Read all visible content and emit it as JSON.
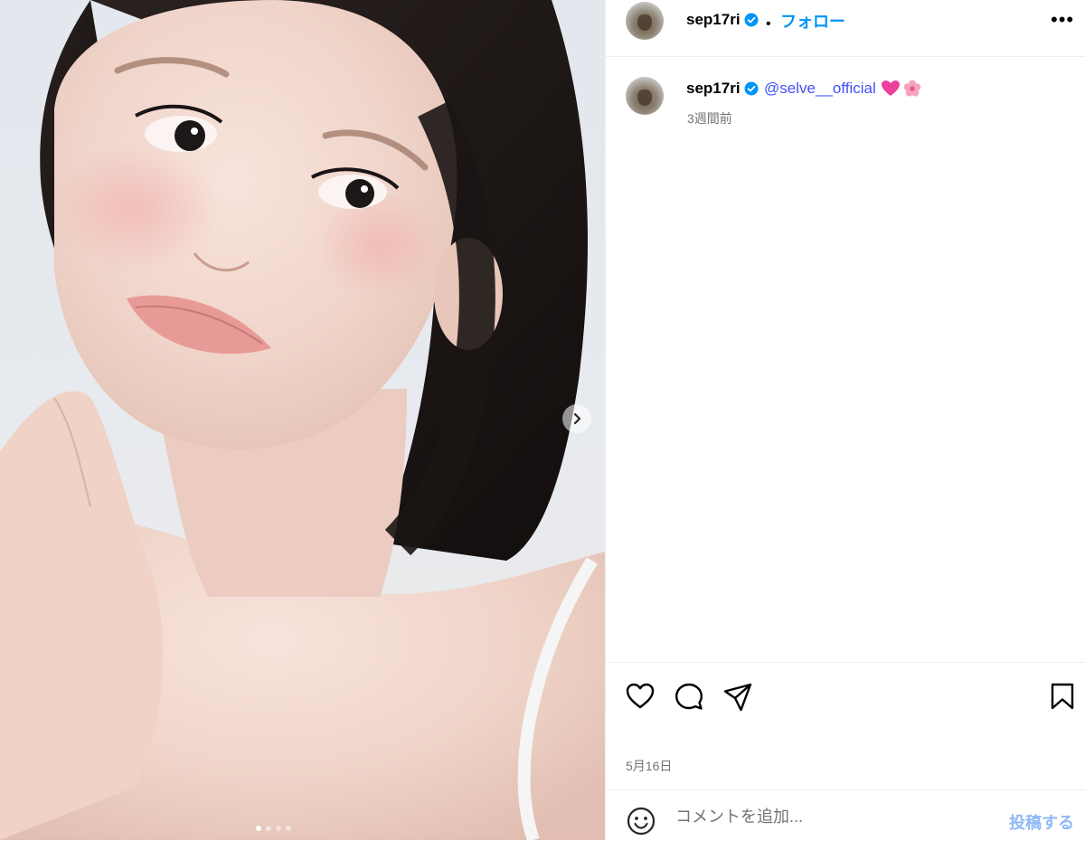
{
  "header": {
    "username": "sep17ri",
    "verified_icon": "verified-badge-icon",
    "separator": "•",
    "follow_label": "フォロー",
    "more_label": "•••"
  },
  "caption": {
    "username": "sep17ri",
    "mention": "@selve__official",
    "emojis": [
      "pink-heart-emoji",
      "cherry-blossom-emoji"
    ],
    "time_ago": "3週間前"
  },
  "media": {
    "description_icon": "portrait-photo",
    "carousel_count": 4,
    "carousel_active_index": 0
  },
  "actions": {
    "like_icon": "heart-icon",
    "comment_icon": "comment-icon",
    "share_icon": "share-icon",
    "save_icon": "bookmark-icon"
  },
  "post_date": "5月16日",
  "comment": {
    "placeholder": "コメントを追加...",
    "submit_label": "投稿する"
  },
  "colors": {
    "accent_blue": "#0095f6",
    "mention_blue": "#4150f7",
    "muted_text": "#737373",
    "submit_disabled": "#8fb9f6"
  }
}
